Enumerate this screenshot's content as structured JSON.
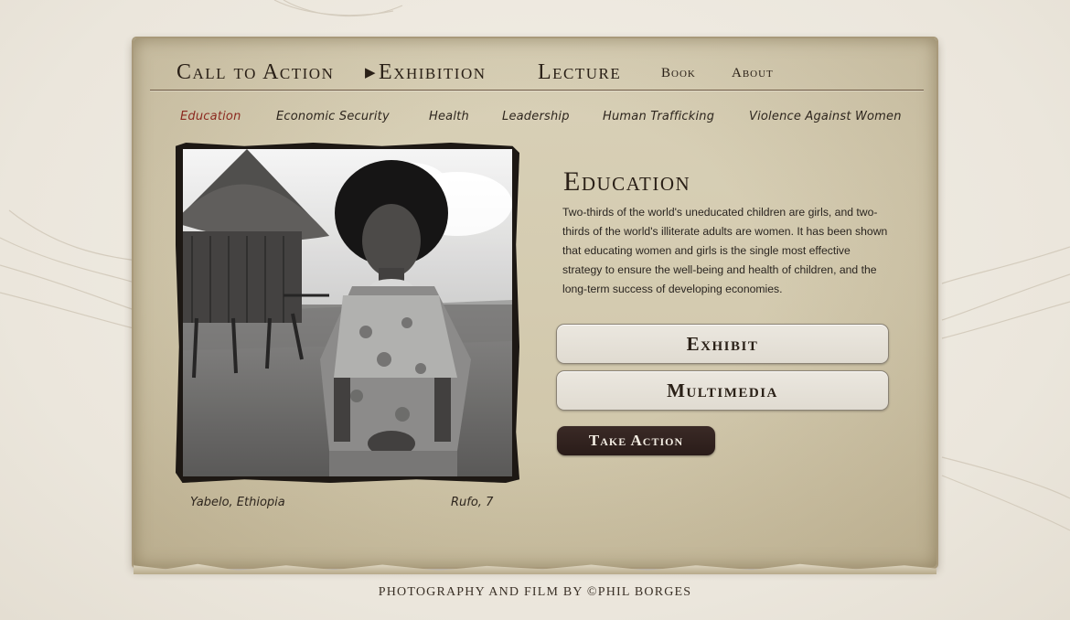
{
  "main_nav": {
    "items": [
      {
        "label": "Call to Action",
        "active": false
      },
      {
        "label": "Exhibition",
        "active": true
      },
      {
        "label": "Lecture",
        "active": false
      },
      {
        "label": "Book",
        "active": false
      },
      {
        "label": "About",
        "active": false
      }
    ],
    "active_marker_icon": "play-triangle-icon"
  },
  "sub_nav": {
    "items": [
      {
        "label": "Education",
        "active": true
      },
      {
        "label": "Economic Security",
        "active": false
      },
      {
        "label": "Health",
        "active": false
      },
      {
        "label": "Leadership",
        "active": false
      },
      {
        "label": "Human Trafficking",
        "active": false
      },
      {
        "label": "Violence Against Women",
        "active": false
      }
    ]
  },
  "photo": {
    "location": "Yabelo, Ethiopia",
    "subject": "Rufo, 7"
  },
  "section": {
    "title": "Education",
    "body": "Two-thirds of the world's uneducated children are girls, and two-thirds of the world's illiterate adults are women. It has been shown that educating women and girls is the single most effective strategy to ensure the well-being and health of children, and the long-term success of developing economies."
  },
  "buttons": {
    "exhibit": "Exhibit",
    "multimedia": "Multimedia",
    "take_action": "Take Action"
  },
  "footer": {
    "credit": "PHOTOGRAPHY AND FILM BY ©PHIL BORGES"
  },
  "colors": {
    "active_subnav": "#8c2a20",
    "dark_button": "#2a1c19",
    "text": "#2a2017"
  }
}
